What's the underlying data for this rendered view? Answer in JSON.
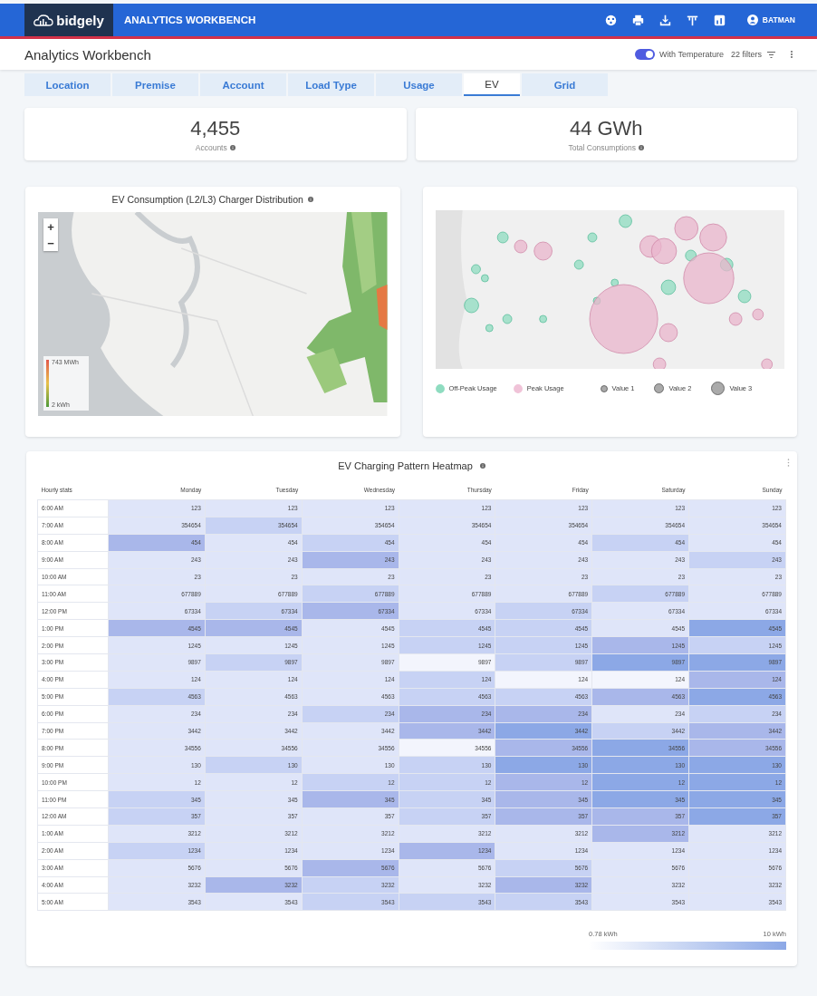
{
  "header": {
    "logo": "bidgely",
    "app_title": "ANALYTICS WORKBENCH",
    "user": "BATMAN"
  },
  "subheader": {
    "title": "Analytics Workbench",
    "temperature_toggle": {
      "label": "With Temperature",
      "on": true
    },
    "filters": "22 filters"
  },
  "tabs": [
    {
      "label": "Location",
      "selected": false
    },
    {
      "label": "Premise",
      "selected": false
    },
    {
      "label": "Account",
      "selected": false
    },
    {
      "label": "Load Type",
      "selected": false
    },
    {
      "label": "Usage",
      "selected": false
    },
    {
      "label": "EV",
      "selected": true
    },
    {
      "label": "Grid",
      "selected": false
    }
  ],
  "kpis": [
    {
      "value": "4,455",
      "label": "Accounts"
    },
    {
      "value": "44 GWh",
      "label": "Total Consumptions"
    }
  ],
  "charger_map": {
    "title": "EV Consumption (L2/L3) Charger Distribution",
    "zoom_in": "+",
    "zoom_out": "−",
    "legend_max": "743 MWh",
    "legend_min": "2 kWh"
  },
  "bubble_map": {
    "legend": [
      {
        "label": "Off-Peak Usage",
        "color": "#8fdcc0",
        "kind": "series"
      },
      {
        "label": "Peak Usage",
        "color": "#f0c3d8",
        "kind": "series"
      },
      {
        "label": "Value 1",
        "kind": "size"
      },
      {
        "label": "Value 2",
        "kind": "size"
      },
      {
        "label": "Value 3",
        "kind": "size"
      }
    ]
  },
  "heatmap": {
    "title": "EV Charging Pattern Heatmap",
    "row_header": "Hourly stats",
    "columns": [
      "Monday",
      "Tuesday",
      "Wednesday",
      "Thursday",
      "Friday",
      "Saturday",
      "Sunday"
    ],
    "rows": [
      {
        "label": "6:00 AM",
        "cells": [
          {
            "value": "123",
            "color": "#dfe5f9"
          },
          {
            "value": "123",
            "color": "#dfe5f9"
          },
          {
            "value": "123",
            "color": "#dfe5f9"
          },
          {
            "value": "123",
            "color": "#dfe5f9"
          },
          {
            "value": "123",
            "color": "#dfe5f9"
          },
          {
            "value": "123",
            "color": "#dfe5f9"
          },
          {
            "value": "123",
            "color": "#dfe5f9"
          }
        ]
      },
      {
        "label": "7:00 AM",
        "cells": [
          {
            "value": "354654",
            "color": "#dfe5f9"
          },
          {
            "value": "354654",
            "color": "#c7d2f4"
          },
          {
            "value": "354654",
            "color": "#dfe5f9"
          },
          {
            "value": "354654",
            "color": "#dfe5f9"
          },
          {
            "value": "354654",
            "color": "#dfe5f9"
          },
          {
            "value": "354654",
            "color": "#dfe5f9"
          },
          {
            "value": "354654",
            "color": "#dfe5f9"
          }
        ]
      },
      {
        "label": "8:00 AM",
        "cells": [
          {
            "value": "454",
            "color": "#a9b7ea"
          },
          {
            "value": "454",
            "color": "#dfe5f9"
          },
          {
            "value": "454",
            "color": "#c7d2f4"
          },
          {
            "value": "454",
            "color": "#dfe5f9"
          },
          {
            "value": "454",
            "color": "#dfe5f9"
          },
          {
            "value": "454",
            "color": "#c7d2f4"
          },
          {
            "value": "454",
            "color": "#dfe5f9"
          }
        ]
      },
      {
        "label": "9:00 AM",
        "cells": [
          {
            "value": "243",
            "color": "#dfe5f9"
          },
          {
            "value": "243",
            "color": "#dfe5f9"
          },
          {
            "value": "243",
            "color": "#a9b7ea"
          },
          {
            "value": "243",
            "color": "#dfe5f9"
          },
          {
            "value": "243",
            "color": "#dfe5f9"
          },
          {
            "value": "243",
            "color": "#dfe5f9"
          },
          {
            "value": "243",
            "color": "#c7d2f4"
          }
        ]
      },
      {
        "label": "10:00 AM",
        "cells": [
          {
            "value": "23",
            "color": "#dfe5f9"
          },
          {
            "value": "23",
            "color": "#dfe5f9"
          },
          {
            "value": "23",
            "color": "#dfe5f9"
          },
          {
            "value": "23",
            "color": "#dfe5f9"
          },
          {
            "value": "23",
            "color": "#dfe5f9"
          },
          {
            "value": "23",
            "color": "#dfe5f9"
          },
          {
            "value": "23",
            "color": "#dfe5f9"
          }
        ]
      },
      {
        "label": "11:00 AM",
        "cells": [
          {
            "value": "677889",
            "color": "#dfe5f9"
          },
          {
            "value": "677889",
            "color": "#dfe5f9"
          },
          {
            "value": "677889",
            "color": "#c7d2f4"
          },
          {
            "value": "677889",
            "color": "#dfe5f9"
          },
          {
            "value": "677889",
            "color": "#dfe5f9"
          },
          {
            "value": "677889",
            "color": "#c7d2f4"
          },
          {
            "value": "677889",
            "color": "#dfe5f9"
          }
        ]
      },
      {
        "label": "12:00 PM",
        "cells": [
          {
            "value": "67334",
            "color": "#dfe5f9"
          },
          {
            "value": "67334",
            "color": "#c7d2f4"
          },
          {
            "value": "67334",
            "color": "#a9b7ea"
          },
          {
            "value": "67334",
            "color": "#dfe5f9"
          },
          {
            "value": "67334",
            "color": "#c7d2f4"
          },
          {
            "value": "67334",
            "color": "#dfe5f9"
          },
          {
            "value": "67334",
            "color": "#dfe5f9"
          }
        ]
      },
      {
        "label": "1:00 PM",
        "cells": [
          {
            "value": "4545",
            "color": "#a9b7ea"
          },
          {
            "value": "4545",
            "color": "#a9b7ea"
          },
          {
            "value": "4545",
            "color": "#dfe5f9"
          },
          {
            "value": "4545",
            "color": "#c7d2f4"
          },
          {
            "value": "4545",
            "color": "#c7d2f4"
          },
          {
            "value": "4545",
            "color": "#dfe5f9"
          },
          {
            "value": "4545",
            "color": "#8ca8e6"
          }
        ]
      },
      {
        "label": "2:00 PM",
        "cells": [
          {
            "value": "1245",
            "color": "#dfe5f9"
          },
          {
            "value": "1245",
            "color": "#dfe5f9"
          },
          {
            "value": "1245",
            "color": "#dfe5f9"
          },
          {
            "value": "1245",
            "color": "#c7d2f4"
          },
          {
            "value": "1245",
            "color": "#c7d2f4"
          },
          {
            "value": "1245",
            "color": "#a9b7ea"
          },
          {
            "value": "1245",
            "color": "#c7d2f4"
          }
        ]
      },
      {
        "label": "3:00 PM",
        "cells": [
          {
            "value": "9897",
            "color": "#dfe5f9"
          },
          {
            "value": "9897",
            "color": "#c7d2f4"
          },
          {
            "value": "9897",
            "color": "#dfe5f9"
          },
          {
            "value": "9897",
            "color": "#f3f5fd"
          },
          {
            "value": "9897",
            "color": "#c7d2f4"
          },
          {
            "value": "9897",
            "color": "#8ca8e6"
          },
          {
            "value": "9897",
            "color": "#8ca8e6"
          }
        ]
      },
      {
        "label": "4:00 PM",
        "cells": [
          {
            "value": "124",
            "color": "#dfe5f9"
          },
          {
            "value": "124",
            "color": "#dfe5f9"
          },
          {
            "value": "124",
            "color": "#dfe5f9"
          },
          {
            "value": "124",
            "color": "#c7d2f4"
          },
          {
            "value": "124",
            "color": "#f3f5fd"
          },
          {
            "value": "124",
            "color": "#f3f5fd"
          },
          {
            "value": "124",
            "color": "#a9b7ea"
          }
        ]
      },
      {
        "label": "5:00 PM",
        "cells": [
          {
            "value": "4563",
            "color": "#c7d2f4"
          },
          {
            "value": "4563",
            "color": "#dfe5f9"
          },
          {
            "value": "4563",
            "color": "#dfe5f9"
          },
          {
            "value": "4563",
            "color": "#c7d2f4"
          },
          {
            "value": "4563",
            "color": "#c7d2f4"
          },
          {
            "value": "4563",
            "color": "#a9b7ea"
          },
          {
            "value": "4563",
            "color": "#8ca8e6"
          }
        ]
      },
      {
        "label": "6:00 PM",
        "cells": [
          {
            "value": "234",
            "color": "#dfe5f9"
          },
          {
            "value": "234",
            "color": "#dfe5f9"
          },
          {
            "value": "234",
            "color": "#c7d2f4"
          },
          {
            "value": "234",
            "color": "#a9b7ea"
          },
          {
            "value": "234",
            "color": "#a9b7ea"
          },
          {
            "value": "234",
            "color": "#dfe5f9"
          },
          {
            "value": "234",
            "color": "#c7d2f4"
          }
        ]
      },
      {
        "label": "7:00 PM",
        "cells": [
          {
            "value": "3442",
            "color": "#dfe5f9"
          },
          {
            "value": "3442",
            "color": "#dfe5f9"
          },
          {
            "value": "3442",
            "color": "#dfe5f9"
          },
          {
            "value": "3442",
            "color": "#a9b7ea"
          },
          {
            "value": "3442",
            "color": "#8ca8e6"
          },
          {
            "value": "3442",
            "color": "#c7d2f4"
          },
          {
            "value": "3442",
            "color": "#a9b7ea"
          }
        ]
      },
      {
        "label": "8:00 PM",
        "cells": [
          {
            "value": "34556",
            "color": "#dfe5f9"
          },
          {
            "value": "34556",
            "color": "#dfe5f9"
          },
          {
            "value": "34556",
            "color": "#dfe5f9"
          },
          {
            "value": "34556",
            "color": "#f3f5fd"
          },
          {
            "value": "34556",
            "color": "#a9b7ea"
          },
          {
            "value": "34556",
            "color": "#8ca8e6"
          },
          {
            "value": "34556",
            "color": "#a9b7ea"
          }
        ]
      },
      {
        "label": "9:00 PM",
        "cells": [
          {
            "value": "130",
            "color": "#dfe5f9"
          },
          {
            "value": "130",
            "color": "#c7d2f4"
          },
          {
            "value": "130",
            "color": "#dfe5f9"
          },
          {
            "value": "130",
            "color": "#c7d2f4"
          },
          {
            "value": "130",
            "color": "#8ca8e6"
          },
          {
            "value": "130",
            "color": "#8ca8e6"
          },
          {
            "value": "130",
            "color": "#8ca8e6"
          }
        ]
      },
      {
        "label": "10:00 PM",
        "cells": [
          {
            "value": "12",
            "color": "#dfe5f9"
          },
          {
            "value": "12",
            "color": "#dfe5f9"
          },
          {
            "value": "12",
            "color": "#c7d2f4"
          },
          {
            "value": "12",
            "color": "#c7d2f4"
          },
          {
            "value": "12",
            "color": "#a9b7ea"
          },
          {
            "value": "12",
            "color": "#8ca8e6"
          },
          {
            "value": "12",
            "color": "#8ca8e6"
          }
        ]
      },
      {
        "label": "11:00 PM",
        "cells": [
          {
            "value": "345",
            "color": "#c7d2f4"
          },
          {
            "value": "345",
            "color": "#dfe5f9"
          },
          {
            "value": "345",
            "color": "#a9b7ea"
          },
          {
            "value": "345",
            "color": "#c7d2f4"
          },
          {
            "value": "345",
            "color": "#a9b7ea"
          },
          {
            "value": "345",
            "color": "#8ca8e6"
          },
          {
            "value": "345",
            "color": "#8ca8e6"
          }
        ]
      },
      {
        "label": "12:00 AM",
        "cells": [
          {
            "value": "357",
            "color": "#c7d2f4"
          },
          {
            "value": "357",
            "color": "#dfe5f9"
          },
          {
            "value": "357",
            "color": "#dfe5f9"
          },
          {
            "value": "357",
            "color": "#c7d2f4"
          },
          {
            "value": "357",
            "color": "#a9b7ea"
          },
          {
            "value": "357",
            "color": "#a9b7ea"
          },
          {
            "value": "357",
            "color": "#8ca8e6"
          }
        ]
      },
      {
        "label": "1:00 AM",
        "cells": [
          {
            "value": "3212",
            "color": "#dfe5f9"
          },
          {
            "value": "3212",
            "color": "#dfe5f9"
          },
          {
            "value": "3212",
            "color": "#dfe5f9"
          },
          {
            "value": "3212",
            "color": "#dfe5f9"
          },
          {
            "value": "3212",
            "color": "#dfe5f9"
          },
          {
            "value": "3212",
            "color": "#a9b7ea"
          },
          {
            "value": "3212",
            "color": "#dfe5f9"
          }
        ]
      },
      {
        "label": "2:00 AM",
        "cells": [
          {
            "value": "1234",
            "color": "#c7d2f4"
          },
          {
            "value": "1234",
            "color": "#dfe5f9"
          },
          {
            "value": "1234",
            "color": "#dfe5f9"
          },
          {
            "value": "1234",
            "color": "#a9b7ea"
          },
          {
            "value": "1234",
            "color": "#dfe5f9"
          },
          {
            "value": "1234",
            "color": "#dfe5f9"
          },
          {
            "value": "1234",
            "color": "#dfe5f9"
          }
        ]
      },
      {
        "label": "3:00 AM",
        "cells": [
          {
            "value": "5676",
            "color": "#dfe5f9"
          },
          {
            "value": "5676",
            "color": "#dfe5f9"
          },
          {
            "value": "5676",
            "color": "#a9b7ea"
          },
          {
            "value": "5676",
            "color": "#dfe5f9"
          },
          {
            "value": "5676",
            "color": "#c7d2f4"
          },
          {
            "value": "5676",
            "color": "#dfe5f9"
          },
          {
            "value": "5676",
            "color": "#dfe5f9"
          }
        ]
      },
      {
        "label": "4:00 AM",
        "cells": [
          {
            "value": "3232",
            "color": "#dfe5f9"
          },
          {
            "value": "3232",
            "color": "#a9b7ea"
          },
          {
            "value": "3232",
            "color": "#c7d2f4"
          },
          {
            "value": "3232",
            "color": "#dfe5f9"
          },
          {
            "value": "3232",
            "color": "#a9b7ea"
          },
          {
            "value": "3232",
            "color": "#dfe5f9"
          },
          {
            "value": "3232",
            "color": "#dfe5f9"
          }
        ]
      },
      {
        "label": "5:00 AM",
        "cells": [
          {
            "value": "3543",
            "color": "#dfe5f9"
          },
          {
            "value": "3543",
            "color": "#dfe5f9"
          },
          {
            "value": "3543",
            "color": "#c7d2f4"
          },
          {
            "value": "3543",
            "color": "#c7d2f4"
          },
          {
            "value": "3543",
            "color": "#c7d2f4"
          },
          {
            "value": "3543",
            "color": "#dfe5f9"
          },
          {
            "value": "3543",
            "color": "#dfe5f9"
          }
        ]
      }
    ],
    "scale_min": "0.78 kWh",
    "scale_max": "10 kWh"
  }
}
